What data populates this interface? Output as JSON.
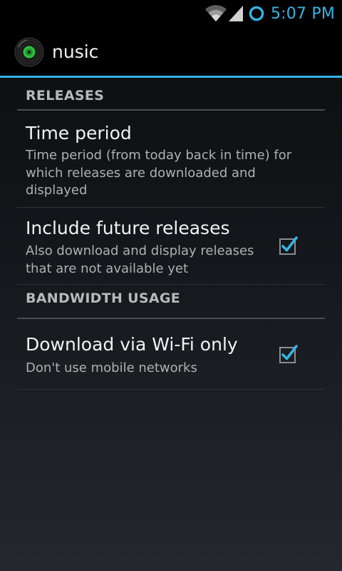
{
  "status_bar": {
    "time": "5:07 PM",
    "accent_color": "#33b5e5",
    "icons": [
      "wifi-icon",
      "signal-icon",
      "sync-ring-icon"
    ]
  },
  "action_bar": {
    "app_icon": "vinyl-record-icon",
    "title": "nusic"
  },
  "preferences": {
    "releases_header": "RELEASES",
    "time_period": {
      "title": "Time period",
      "summary": "Time period (from today back in time) for which releases are downloaded and displayed"
    },
    "future_releases": {
      "title": "Include future releases",
      "summary": "Also download and display releases that are not available yet",
      "checked": true
    },
    "bandwidth_header": "BANDWIDTH USAGE",
    "wifi_only": {
      "title": "Download via Wi-Fi only",
      "summary": "Don't use mobile networks",
      "checked": true
    }
  }
}
